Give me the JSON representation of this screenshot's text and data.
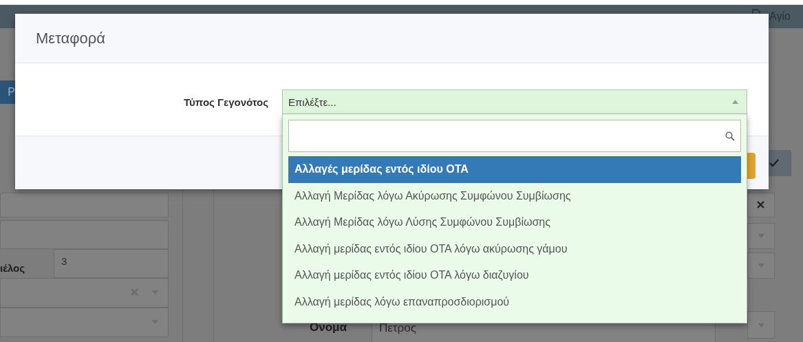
{
  "top_bar": {
    "user_text": "Αγίο"
  },
  "background": {
    "tab_text": "Ρ",
    "member_label": "ιέλος",
    "member_value": "3",
    "name_label": "Ονομα",
    "name_value": "Πετρος"
  },
  "modal": {
    "title": "Μεταφορά",
    "field_label": "Τύπος Γεγονότος",
    "select": {
      "placeholder": "Επιλέξτε...",
      "expanded": true
    },
    "options": [
      {
        "label": "Αλλαγές μερίδας εντός ιδίου ΟΤΑ",
        "selected": true
      },
      {
        "label": "Αλλαγή Μερίδας λόγω Ακύρωσης Συμφώνου Συμβίωσης",
        "selected": false
      },
      {
        "label": "Αλλαγή Μερίδας λόγω Λύσης Συμφώνου Συμβίωσης",
        "selected": false
      },
      {
        "label": "Αλλαγή μερίδας εντός ιδίου ΟΤΑ λόγω ακύρωσης γάμου",
        "selected": false
      },
      {
        "label": "Αλλαγή μερίδας εντός ιδίου ΟΤΑ λόγω διαζυγίου",
        "selected": false
      },
      {
        "label": "Αλλαγή μερίδας λόγω επαναπροσδιορισμού",
        "selected": false
      }
    ]
  }
}
